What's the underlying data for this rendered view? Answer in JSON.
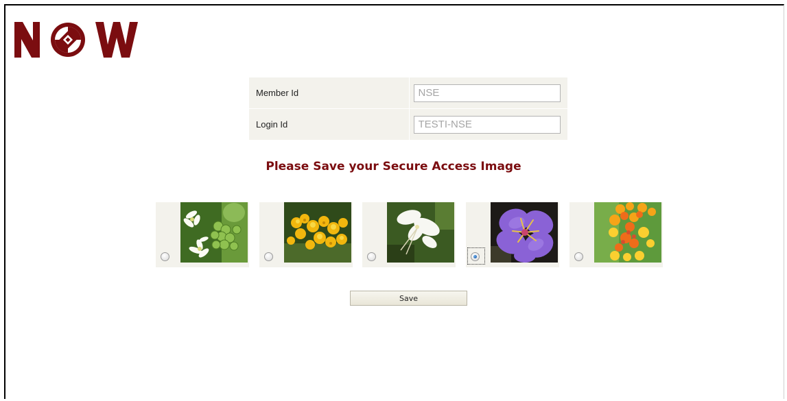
{
  "logo": {
    "text": "NOW",
    "color": "#7b0d10"
  },
  "form": {
    "member_id": {
      "label": "Member Id",
      "value": "NSE"
    },
    "login_id": {
      "label": "Login Id",
      "value": "TESTI-NSE"
    }
  },
  "heading": "Please Save your Secure Access Image",
  "images": [
    {
      "name": "white-green-buds-flower",
      "selected": false
    },
    {
      "name": "yellow-flower-cluster",
      "selected": false
    },
    {
      "name": "white-flower",
      "selected": false
    },
    {
      "name": "purple-flower",
      "selected": true
    },
    {
      "name": "orange-yellow-lantana",
      "selected": false
    }
  ],
  "save_label": "Save",
  "colors": {
    "accent": "#7b0d10",
    "panel_bg": "#f3f2ec"
  }
}
